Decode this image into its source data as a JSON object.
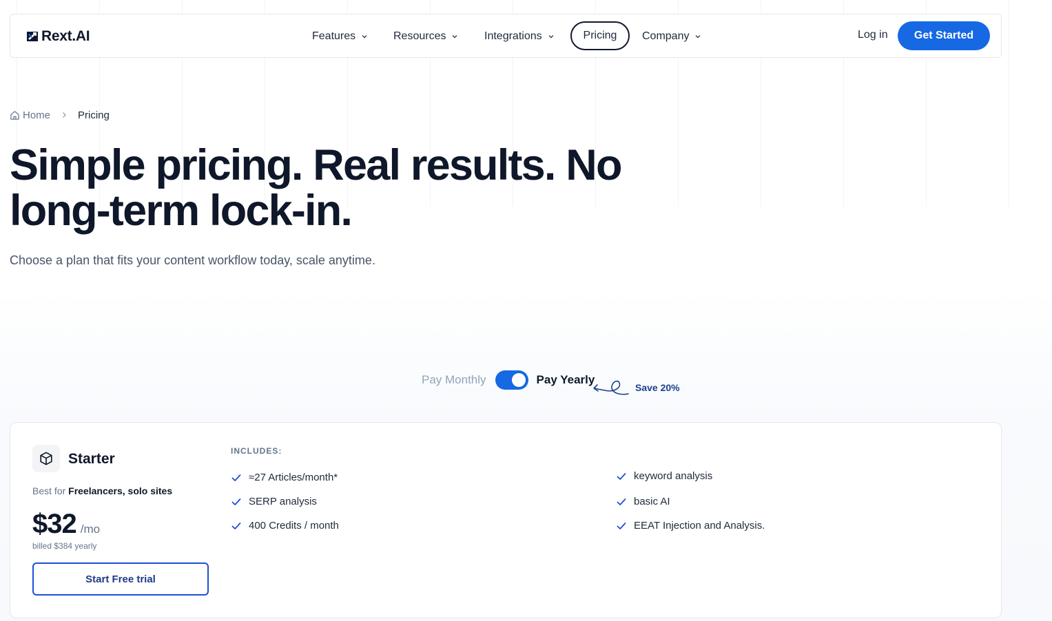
{
  "brand": {
    "name": "Rext.AI"
  },
  "nav": {
    "items": [
      {
        "label": "Features"
      },
      {
        "label": "Resources"
      },
      {
        "label": "Integrations"
      },
      {
        "label": "Pricing"
      },
      {
        "label": "Company"
      }
    ],
    "login_label": "Log in",
    "cta_label": "Get Started"
  },
  "breadcrumb": {
    "home": "Home",
    "current": "Pricing"
  },
  "hero": {
    "headline": "Simple pricing. Real results. No long-term lock-in.",
    "subtitle": "Choose a plan that fits your content workflow today, scale anytime."
  },
  "billing_toggle": {
    "monthly_label": "Pay Monthly",
    "yearly_label": "Pay Yearly",
    "selected": "yearly",
    "save_label": "Save 20%"
  },
  "plan": {
    "name": "Starter",
    "best_for_prefix": "Best for",
    "best_for_audience": "Freelancers, solo sites",
    "price": "$32",
    "period": "/mo",
    "billed_prefix": "billed",
    "billed_amount": "$384",
    "billed_suffix": "yearly",
    "cta_label": "Start Free trial",
    "includes_label": "INCLUDES:",
    "features_left": [
      "≈27 Articles/month*",
      "SERP analysis",
      "400 Credits / month"
    ],
    "features_right": [
      "keyword analysis",
      "basic AI",
      "EEAT Injection and Analysis."
    ]
  },
  "colors": {
    "accent": "#1668e3",
    "text_dark": "#0f172a",
    "muted": "#64748b",
    "save_text": "#1c3f8a"
  },
  "icons": {
    "logo": "rext-logo-icon",
    "chevron": "chevron-down-icon",
    "home": "home-icon",
    "breadcrumb_separator": "chevron-right-icon",
    "plan": "cube-icon",
    "check": "check-icon",
    "arrow": "curly-arrow-icon"
  }
}
